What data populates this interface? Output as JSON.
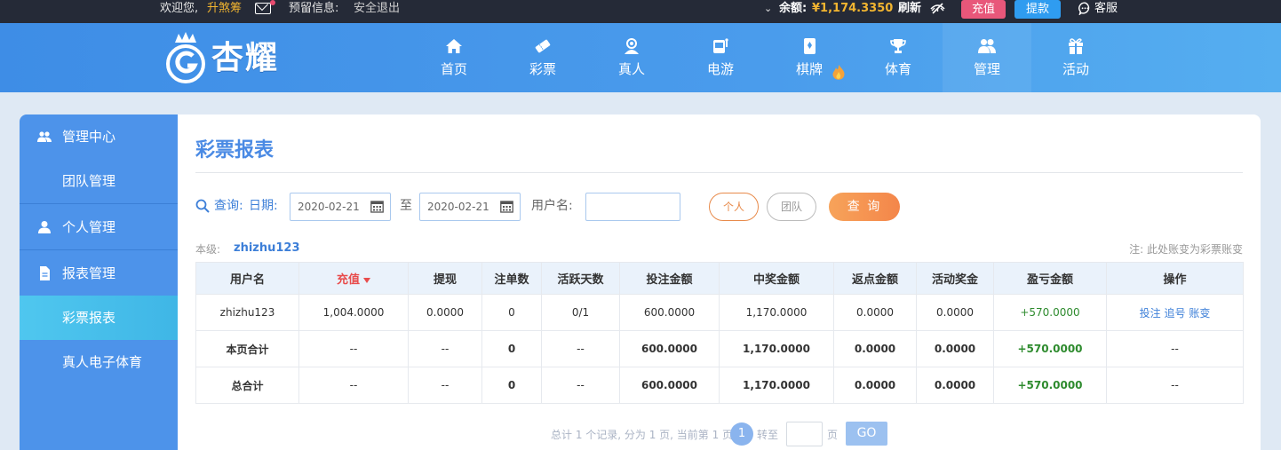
{
  "topbar": {
    "welcome": "欢迎您,",
    "username": "升煞筹",
    "reserved_info": "预留信息:",
    "logout": "安全退出",
    "balance_label": "余额:",
    "balance_value": "¥1,174.3350",
    "refresh": "刷新",
    "recharge": "充值",
    "withdraw": "提款",
    "service": "客服"
  },
  "logo": {
    "text": "杏耀"
  },
  "nav": [
    {
      "label": "首页",
      "icon": "home-icon"
    },
    {
      "label": "彩票",
      "icon": "ticket-icon"
    },
    {
      "label": "真人",
      "icon": "dealer-icon"
    },
    {
      "label": "电游",
      "icon": "slot-icon"
    },
    {
      "label": "棋牌",
      "icon": "card-icon"
    },
    {
      "label": "体育",
      "icon": "trophy-icon"
    },
    {
      "label": "管理",
      "icon": "users-icon",
      "active": true
    },
    {
      "label": "活动",
      "icon": "gift-icon"
    }
  ],
  "sidebar": [
    {
      "label": "管理中心",
      "icon": "group-icon"
    },
    {
      "label": "团队管理"
    },
    {
      "label": "个人管理",
      "icon": "person-icon"
    },
    {
      "label": "报表管理",
      "icon": "report-icon"
    },
    {
      "label": "彩票报表",
      "active": true
    },
    {
      "label": "真人电子体育"
    }
  ],
  "page": {
    "title": "彩票报表"
  },
  "query": {
    "query_label": "查询:",
    "date_label": "日期:",
    "date_from": "2020-02-21",
    "to_label": "至",
    "date_to": "2020-02-21",
    "username_label": "用户名:",
    "username_value": "",
    "personal": "个人",
    "team": "团队",
    "submit": "查 询"
  },
  "level": {
    "label": "本级:",
    "user": "zhizhu123",
    "note": "注: 此处账变为彩票账变"
  },
  "table": {
    "headers": [
      "用户名",
      "充值",
      "提现",
      "注单数",
      "活跃天数",
      "投注金额",
      "中奖金额",
      "返点金额",
      "活动奖金",
      "盈亏金额",
      "操作"
    ],
    "rows": [
      {
        "user": "zhizhu123",
        "recharge": "1,004.0000",
        "withdraw": "0.0000",
        "orders": "0",
        "active_days": "0/1",
        "bet": "600.0000",
        "win": "1,170.0000",
        "rebate": "0.0000",
        "bonus": "0.0000",
        "profit": "+570.0000",
        "op_bet": "投注",
        "op_chase": "追号",
        "op_ledger": "账变"
      }
    ],
    "page_total": {
      "label": "本页合计",
      "recharge": "--",
      "withdraw": "--",
      "orders": "0",
      "active_days": "--",
      "bet": "600.0000",
      "win": "1,170.0000",
      "rebate": "0.0000",
      "bonus": "0.0000",
      "profit": "+570.0000",
      "ops": "--"
    },
    "grand_total": {
      "label": "总合计",
      "recharge": "--",
      "withdraw": "--",
      "orders": "0",
      "active_days": "--",
      "bet": "600.0000",
      "win": "1,170.0000",
      "rebate": "0.0000",
      "bonus": "0.0000",
      "profit": "+570.0000",
      "ops": "--"
    }
  },
  "pagination": {
    "summary": "总计 1 个记录, 分为 1 页, 当前第 1 页",
    "current": "1",
    "goto_label": "转至",
    "page_suffix": "页",
    "go": "GO"
  },
  "colors": {
    "brand_blue": "#4a9cec",
    "accent_orange": "#f4864a",
    "profit_green": "#2e8b2e",
    "sort_red": "#e84c4c"
  }
}
